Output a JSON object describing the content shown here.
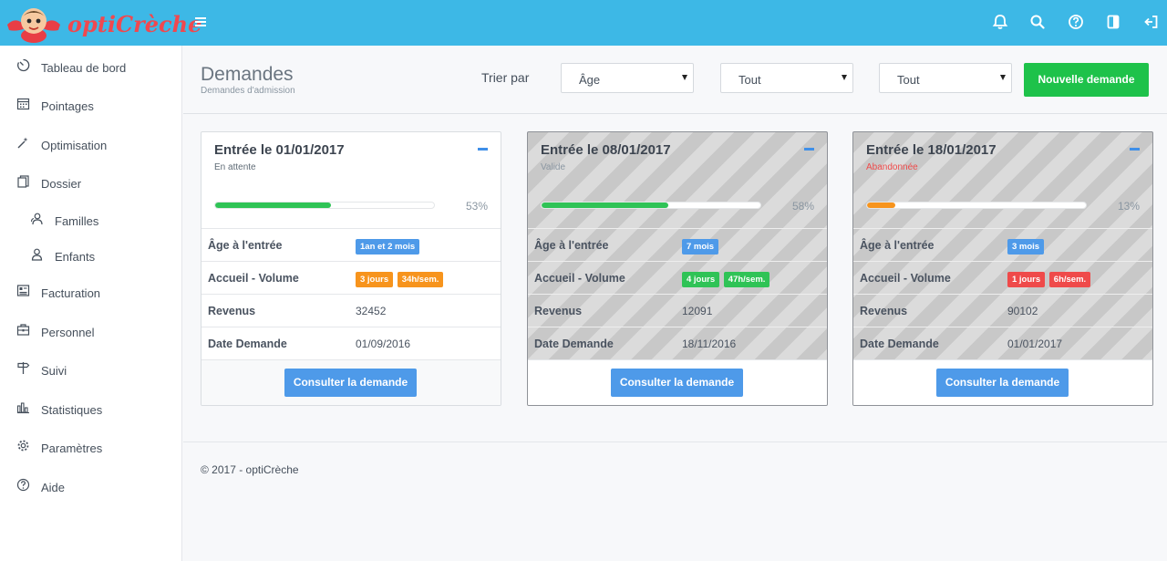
{
  "app": {
    "name": "optiCrèche"
  },
  "topbar": {
    "icons": [
      "menu-icon",
      "bell-icon",
      "search-icon",
      "help-icon",
      "panel-icon",
      "logout-icon"
    ]
  },
  "sidebar": {
    "items": [
      {
        "label": "Tableau de bord",
        "icon": "dashboard-icon"
      },
      {
        "label": "Pointages",
        "icon": "calendar-icon"
      },
      {
        "label": "Optimisation",
        "icon": "wand-icon"
      },
      {
        "label": "Dossier",
        "icon": "folder-icon"
      },
      {
        "label": "Familles",
        "icon": "family-icon"
      },
      {
        "label": "Enfants",
        "icon": "child-icon"
      },
      {
        "label": "Facturation",
        "icon": "invoice-icon"
      },
      {
        "label": "Personnel",
        "icon": "staff-icon"
      },
      {
        "label": "Suivi",
        "icon": "signpost-icon"
      },
      {
        "label": "Statistiques",
        "icon": "stats-icon"
      },
      {
        "label": "Paramètres",
        "icon": "gear-icon"
      },
      {
        "label": "Aide",
        "icon": "help-icon"
      }
    ]
  },
  "header": {
    "title": "Demandes",
    "subtitle": "Demandes d'admission",
    "sort_label": "Trier par",
    "selects": [
      "Âge",
      "Tout",
      "Tout"
    ],
    "new_button": "Nouvelle demande"
  },
  "cards": [
    {
      "title": "Entrée le 01/01/2017",
      "status": "En attente",
      "status_color": "#5f6b76",
      "progress": 53,
      "progress_label": "53%",
      "progress_color": "#2fc356",
      "rows": {
        "age_label": "Âge à l'entrée",
        "age_badge": "1an et 2 mois",
        "volume_label": "Accueil - Volume",
        "volume_badges": [
          "3 jours",
          "34h/sem."
        ],
        "revenue_label": "Revenus",
        "revenue": "32452",
        "date_label": "Date Demande",
        "date": "01/09/2016"
      },
      "button": "Consulter la demande"
    },
    {
      "title": "Entrée le 08/01/2017",
      "status": "Valide",
      "status_color": "#8a96a1",
      "progress": 58,
      "progress_label": "58%",
      "progress_color": "#2fc356",
      "rows": {
        "age_label": "Âge à l'entrée",
        "age_badge": "7 mois",
        "volume_label": "Accueil - Volume",
        "volume_badges": [
          "4 jours",
          "47h/sem."
        ],
        "revenue_label": "Revenus",
        "revenue": "12091",
        "date_label": "Date Demande",
        "date": "18/11/2016"
      },
      "button": "Consulter la demande"
    },
    {
      "title": "Entrée le 18/01/2017",
      "status": "Abandonnée",
      "status_color": "#ef4a4a",
      "progress": 13,
      "progress_label": "13%",
      "progress_color": "#f7941d",
      "rows": {
        "age_label": "Âge à l'entrée",
        "age_badge": "3 mois",
        "volume_label": "Accueil - Volume",
        "volume_badges": [
          "1 jours",
          "6h/sem."
        ],
        "revenue_label": "Revenus",
        "revenue": "90102",
        "date_label": "Date Demande",
        "date": "01/01/2017"
      },
      "button": "Consulter la demande"
    }
  ],
  "colors": {
    "topbar": "#3db8e6",
    "badge_blue": "#4e9ae9",
    "badge_orange": "#f7941d",
    "badge_green": "#2fc356",
    "badge_red": "#ef4a4a",
    "accent_green": "#1ec24a"
  },
  "footer": {
    "text": "© 2017 - optiCrèche"
  }
}
